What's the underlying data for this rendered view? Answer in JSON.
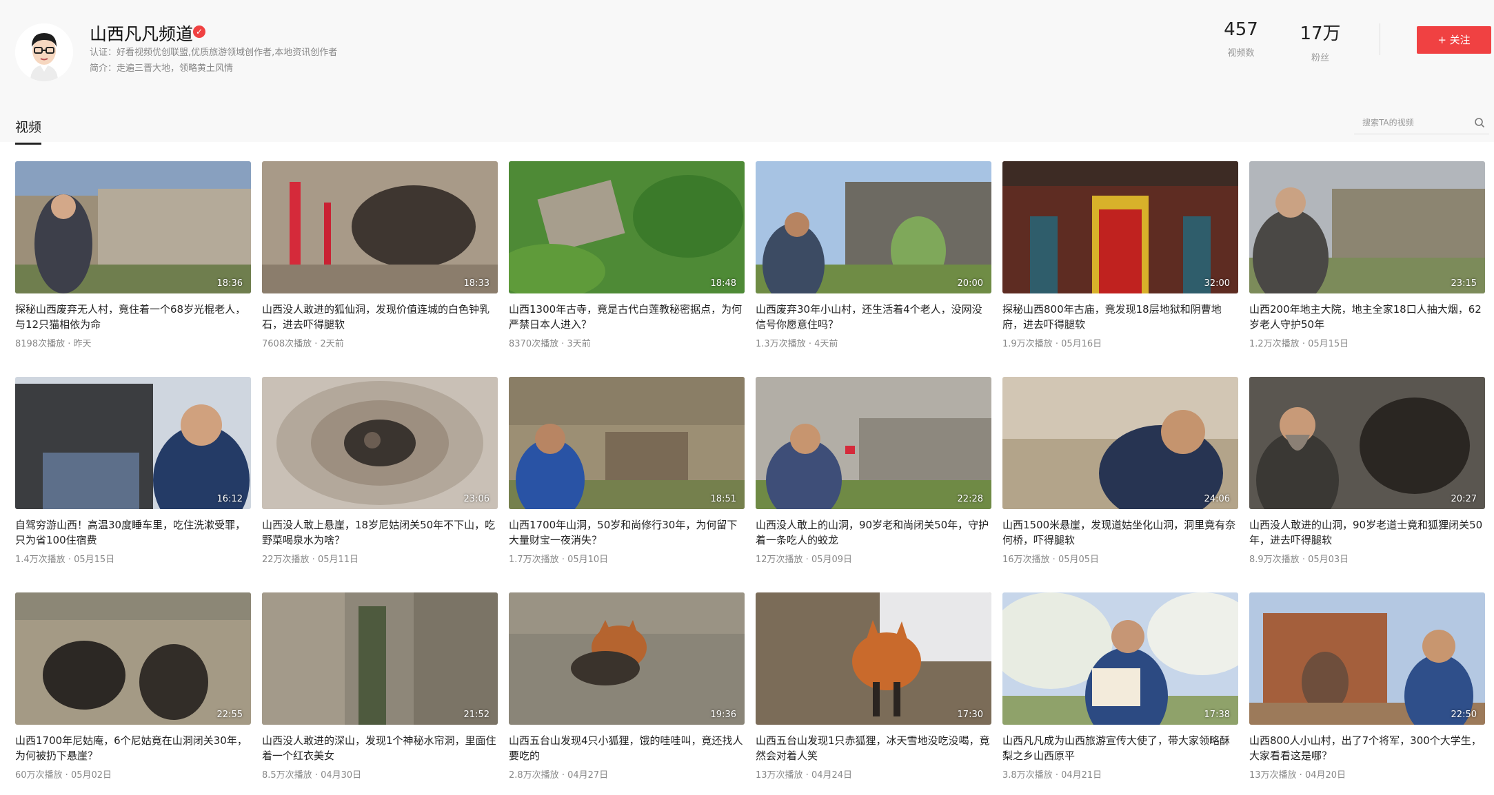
{
  "channel": {
    "name": "山西凡凡频道",
    "verified_icon": "verified-icon",
    "certification": "认证：好看视频优创联盟,优质旅游领域创作者,本地资讯创作者",
    "intro": "简介：走遍三晋大地，领略黄土风情",
    "stats": [
      {
        "value": "457",
        "label": "视频数"
      },
      {
        "value": "17万",
        "label": "粉丝"
      }
    ],
    "follow_label": "+ 关注",
    "accent_color": "#f04142"
  },
  "tabs": [
    {
      "label": "视频"
    }
  ],
  "search": {
    "placeholder": "搜索TA的视频",
    "icon": "search-icon"
  },
  "videos": [
    {
      "title": "探秘山西废弃无人村，竟住着一个68岁光棍老人，与12只猫相依为命",
      "views": "8198次播放",
      "date": "昨天",
      "duration": "18:36"
    },
    {
      "title": "山西没人敢进的狐仙洞，发现价值连城的白色钟乳石，进去吓得腿软",
      "views": "7608次播放",
      "date": "2天前",
      "duration": "18:33"
    },
    {
      "title": "山西1300年古寺，竟是古代白莲教秘密据点，为何严禁日本人进入？",
      "views": "8370次播放",
      "date": "3天前",
      "duration": "18:48"
    },
    {
      "title": "山西废弃30年小山村，还生活着4个老人，没网没信号你愿意住吗？",
      "views": "1.3万次播放",
      "date": "4天前",
      "duration": "20:00"
    },
    {
      "title": "探秘山西800年古庙，竟发现18层地狱和阴曹地府，进去吓得腿软",
      "views": "1.9万次播放",
      "date": "05月16日",
      "duration": "32:00"
    },
    {
      "title": "山西200年地主大院，地主全家18口人抽大烟，62岁老人守护50年",
      "views": "1.2万次播放",
      "date": "05月15日",
      "duration": "23:15"
    },
    {
      "title": "自驾穷游山西！高温30度睡车里，吃住洗漱受罪，只为省100住宿费",
      "views": "1.4万次播放",
      "date": "05月15日",
      "duration": "16:12"
    },
    {
      "title": "山西没人敢上悬崖，18岁尼姑闭关50年不下山，吃野菜喝泉水为啥？",
      "views": "22万次播放",
      "date": "05月11日",
      "duration": "23:06"
    },
    {
      "title": "山西1700年山洞，50岁和尚修行30年，为何留下大量财宝一夜消失？",
      "views": "1.7万次播放",
      "date": "05月10日",
      "duration": "18:51"
    },
    {
      "title": "山西没人敢上的山洞，90岁老和尚闭关50年，守护着一条吃人的蛟龙",
      "views": "12万次播放",
      "date": "05月09日",
      "duration": "22:28"
    },
    {
      "title": "山西1500米悬崖，发现道姑坐化山洞，洞里竟有奈何桥，吓得腿软",
      "views": "16万次播放",
      "date": "05月05日",
      "duration": "24:06"
    },
    {
      "title": "山西没人敢进的山洞，90岁老道士竟和狐狸闭关50年，进去吓得腿软",
      "views": "8.9万次播放",
      "date": "05月03日",
      "duration": "20:27"
    },
    {
      "title": "山西1700年尼姑庵，6个尼姑竟在山洞闭关30年，为何被扔下悬崖？",
      "views": "60万次播放",
      "date": "05月02日",
      "duration": "22:55"
    },
    {
      "title": "山西没人敢进的深山，发现1个神秘水帘洞，里面住着一个红衣美女",
      "views": "8.5万次播放",
      "date": "04月30日",
      "duration": "21:52"
    },
    {
      "title": "山西五台山发现4只小狐狸，饿的哇哇叫，竟还找人要吃的",
      "views": "2.8万次播放",
      "date": "04月27日",
      "duration": "19:36"
    },
    {
      "title": "山西五台山发现1只赤狐狸，冰天雪地没吃没喝，竟然会对着人笑",
      "views": "13万次播放",
      "date": "04月24日",
      "duration": "17:30"
    },
    {
      "title": "山西凡凡成为山西旅游宣传大使了，带大家领略酥梨之乡山西原平",
      "views": "3.8万次播放",
      "date": "04月21日",
      "duration": "17:38"
    },
    {
      "title": "山西800人小山村，出了7个将军，300个大学生，大家看看这是哪？",
      "views": "13万次播放",
      "date": "04月20日",
      "duration": "22:50"
    }
  ]
}
